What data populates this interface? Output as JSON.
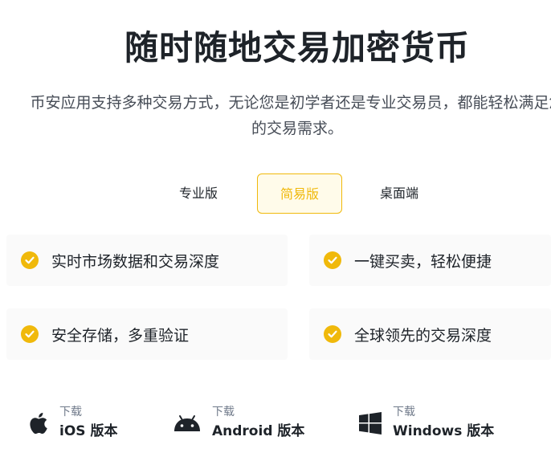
{
  "hero": {
    "title": "随时随地交易加密货币",
    "subtitle_line1": "币安应用支持多种交易方式，无论您是初学者还是专业交易员，都能轻松满足您",
    "subtitle_line2": "的交易需求。"
  },
  "tabs": [
    {
      "label": "专业版",
      "selected": false
    },
    {
      "label": "简易版",
      "selected": true
    },
    {
      "label": "桌面端",
      "selected": false
    }
  ],
  "features": [
    {
      "label": "实时市场数据和交易深度",
      "icon": "check-circle-icon"
    },
    {
      "label": "一键买卖，轻松便捷",
      "icon": "check-circle-icon"
    },
    {
      "label": "安全存储，多重验证",
      "icon": "check-circle-icon"
    },
    {
      "label": "全球领先的交易深度",
      "icon": "check-circle-icon"
    }
  ],
  "downloads": [
    {
      "small": "下载",
      "big": "iOS 版本",
      "icon": "apple-icon"
    },
    {
      "small": "下载",
      "big": "Android 版本",
      "icon": "android-icon"
    },
    {
      "small": "下载",
      "big": "Windows 版本",
      "icon": "windows-icon"
    }
  ],
  "colors": {
    "accent": "#f0b90b",
    "text": "#1e2329",
    "secondary": "#707a8a",
    "feature_bg": "#fafafa"
  }
}
